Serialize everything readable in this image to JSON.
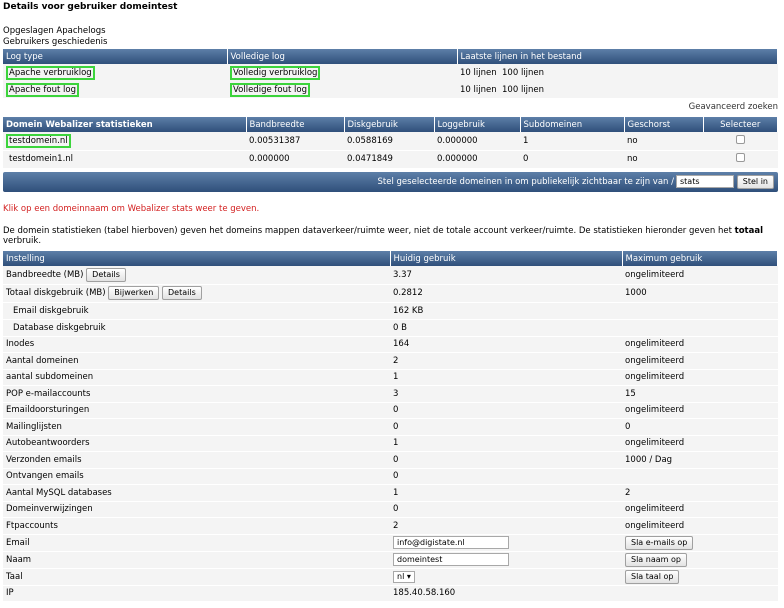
{
  "page": {
    "title": "Details voor gebruiker domeintest",
    "links": [
      "Opgeslagen Apachelogs",
      "Gebruikers geschiedenis"
    ],
    "advanced_search": "Geavanceerd zoeken",
    "click_note": "Klik op een domeinnaam om Webalizer stats weer te geven.",
    "stats_note_pre": "De domein statistieken (tabel hierboven) geven het domeins mappen dataverkeer/ruimte weer, niet de totale account verkeer/ruimte. De statistieken hieronder geven het ",
    "stats_note_bold": "totaal",
    "stats_note_post": " verbruik."
  },
  "logs": {
    "headers": [
      "Log type",
      "Volledige log",
      "Laatste lijnen in het bestand"
    ],
    "rows": [
      {
        "type": "Apache verbruiklog",
        "full": "Volledig verbruiklog",
        "lines10": "10 lijnen",
        "lines100": "100 lijnen"
      },
      {
        "type": "Apache fout log",
        "full": "Volledige fout log",
        "lines10": "10 lijnen",
        "lines100": "100 lijnen"
      }
    ]
  },
  "domains": {
    "headers": [
      "Domein Webalizer statistieken",
      "Bandbreedte",
      "Diskgebruik",
      "Loggebruik",
      "Subdomeinen",
      "Geschorst",
      "Selecteer"
    ],
    "rows": [
      {
        "name": "testdomein.nl",
        "bw": "0.00531387",
        "disk": "0.0588169",
        "log": "0.000000",
        "sub": "1",
        "susp": "no"
      },
      {
        "name": "testdomein1.nl",
        "bw": "0.000000",
        "disk": "0.0471849",
        "log": "0.000000",
        "sub": "0",
        "susp": "no"
      }
    ],
    "action_label": "Stel geselecteerde domeinen in om publiekelijk zichtbaar te zijn van /",
    "action_value": "stats",
    "action_button": "Stel in"
  },
  "usage": {
    "headers": [
      "Instelling",
      "Huidig gebruik",
      "Maximum gebruik"
    ],
    "btn_details": "Details",
    "btn_update": "Bijwerken",
    "rows": [
      {
        "label": "Bandbreedte (MB)",
        "cur": "3.37",
        "max": "ongelimiteerd"
      },
      {
        "label": "Totaal diskgebruik (MB)",
        "cur": "0.2812",
        "max": "1000"
      },
      {
        "label": "Email diskgebruik",
        "cur": "162 KB",
        "max": ""
      },
      {
        "label": "Database diskgebruik",
        "cur": "0 B",
        "max": ""
      },
      {
        "label": "Inodes",
        "cur": "164",
        "max": "ongelimiteerd"
      },
      {
        "label": "Aantal domeinen",
        "cur": "2",
        "max": "ongelimiteerd"
      },
      {
        "label": "aantal subdomeinen",
        "cur": "1",
        "max": "ongelimiteerd"
      },
      {
        "label": "POP e-mailaccounts",
        "cur": "3",
        "max": "15"
      },
      {
        "label": "Emaildoorsturingen",
        "cur": "0",
        "max": "ongelimiteerd"
      },
      {
        "label": "Mailinglijsten",
        "cur": "0",
        "max": "0"
      },
      {
        "label": "Autobeantwoorders",
        "cur": "1",
        "max": "ongelimiteerd"
      },
      {
        "label": "Verzonden emails",
        "cur": "0",
        "max": "1000 / Dag"
      },
      {
        "label": "Ontvangen emails",
        "cur": "0",
        "max": ""
      },
      {
        "label": "Aantal MySQL databases",
        "cur": "1",
        "max": "2"
      },
      {
        "label": "Domeinverwijzingen",
        "cur": "0",
        "max": "ongelimiteerd"
      },
      {
        "label": "Ftpaccounts",
        "cur": "2",
        "max": "ongelimiteerd"
      }
    ],
    "email_label": "Email",
    "email_value": "info@digistate.nl",
    "email_button": "Sla e-mails op",
    "name_label": "Naam",
    "name_value": "domeintest",
    "name_button": "Sla naam op",
    "lang_label": "Taal",
    "lang_value": "nl",
    "lang_button": "Sla taal op",
    "ip_label": "IP",
    "ip_value": "185.40.58.160"
  }
}
